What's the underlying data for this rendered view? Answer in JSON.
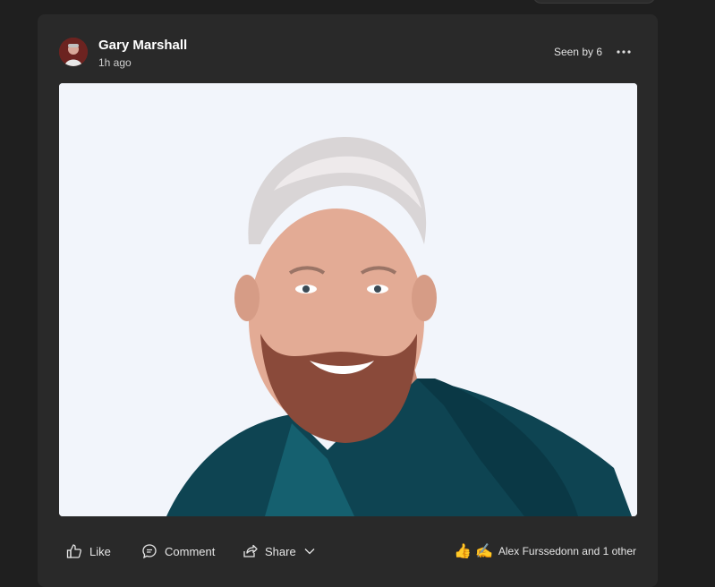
{
  "post": {
    "author_name": "Gary Marshall",
    "timestamp": "1h ago",
    "seen_by": "Seen by 6",
    "more_icon": "more-icon",
    "avatar_icon": "avatar",
    "photo_description_icon": "post-photo"
  },
  "actions": {
    "like_label": "Like",
    "comment_label": "Comment",
    "share_label": "Share"
  },
  "reactions": {
    "emoji_1": "👍",
    "emoji_2": "✍",
    "summary": "Alex Furssedonn and 1 other"
  },
  "colors": {
    "background": "#1f1f1f",
    "card": "#292929",
    "text": "#ffffff",
    "photo_bg": "#f2f5fb",
    "shirt": "#0e4452"
  }
}
